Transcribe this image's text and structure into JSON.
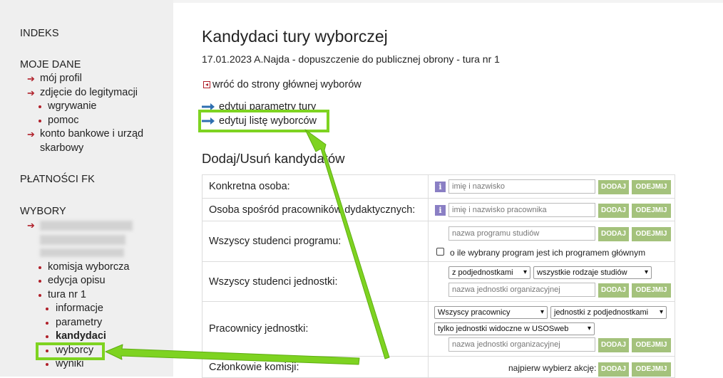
{
  "sidebar": {
    "indeks": "INDEKS",
    "moje_dane": "MOJE DANE",
    "moj_profil": "mój profil",
    "zdjecie": "zdjęcie do legitymacji",
    "wgrywanie": "wgrywanie",
    "pomoc": "pomoc",
    "konto_1": "konto bankowe i urząd",
    "konto_2": "skarbowy",
    "platnosci": "PŁATNOŚCI FK",
    "wybory": "WYBORY",
    "komisja": "komisja wyborcza",
    "edycja": "edycja opisu",
    "tura": "tura nr 1",
    "informacje": "informacje",
    "parametry": "parametry",
    "kandydaci": "kandydaci",
    "wyborcy": "wyborcy",
    "wyniki": "wyniki"
  },
  "main": {
    "title": "Kandydaci tury wyborczej",
    "subtitle": "17.01.2023 A.Najda - dopuszczenie do publicznej obrony - tura nr 1",
    "back_link": "wróć do strony głównej wyborów",
    "edit_params": "edytuj parametry tury",
    "edit_voters": "edytuj listę wyborców",
    "section_title": "Dodaj/Usuń kandydatów"
  },
  "table": {
    "row1_label": "Konkretna osoba:",
    "row1_placeholder": "imię i nazwisko",
    "row2_label": "Osoba spośród pracowników dydaktycznych:",
    "row2_placeholder": "imię i nazwisko pracownika",
    "row3_label": "Wszyscy studenci programu:",
    "row3_placeholder": "nazwa programu studiów",
    "row3_checkbox": "o ile wybrany program jest ich programem głównym",
    "row4_label": "Wszyscy studenci jednostki:",
    "row4_select1": "z podjednostkami",
    "row4_select2": "wszystkie rodzaje studiów",
    "row4_placeholder": "nazwa jednostki organizacyjnej",
    "row5_label": "Pracownicy jednostki:",
    "row5_select1": "Wszyscy pracownicy",
    "row5_select2": "jednostki z podjednostkami",
    "row5_select3": "tylko jednostki widoczne w USOSweb",
    "row5_placeholder": "nazwa jednostki organizacyjnej",
    "row6_label": "Członkowie komisji:",
    "row6_note": "najpierw wybierz akcję:",
    "add": "DODAJ",
    "remove": "ODEJMIJ",
    "info": "i"
  },
  "colors": {
    "highlight": "#7ed321",
    "button": "#a4c27c",
    "bullet": "#b0202a",
    "link_arrow": "#2e6fb0"
  }
}
